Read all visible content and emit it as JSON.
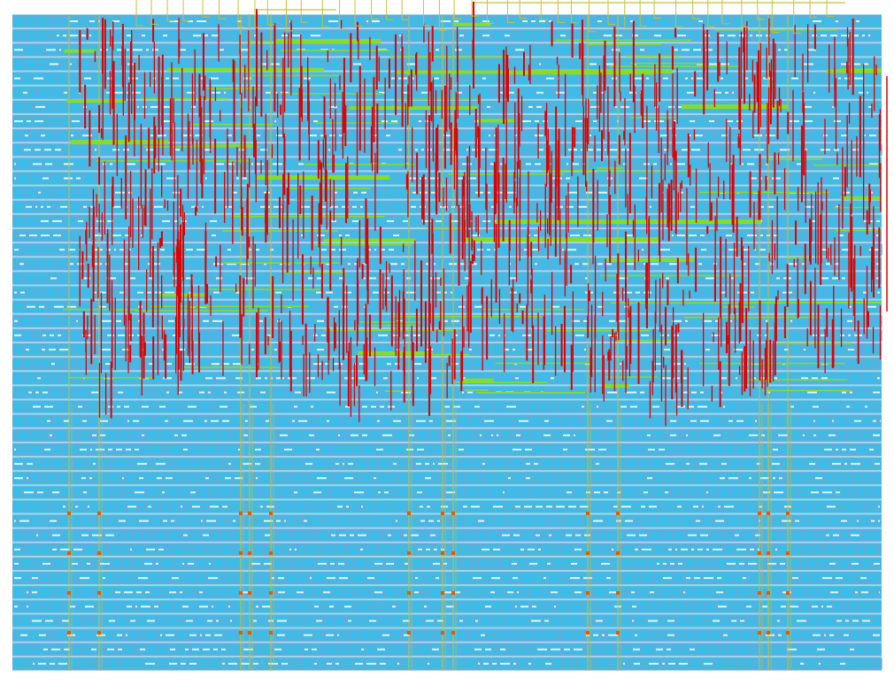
{
  "view": {
    "type": "chip-layout-render",
    "background": "#ffffff",
    "layers": [
      {
        "name": "standard-cells",
        "color": "#2ab7e8"
      },
      {
        "name": "cell-outline",
        "color": "#8a9fc0"
      },
      {
        "name": "metal-vertical",
        "color": "#dd0000"
      },
      {
        "name": "metal-horizontal",
        "color": "#86dc2c"
      },
      {
        "name": "power-straps",
        "color": "#c8be3c"
      },
      {
        "name": "io-pins",
        "color": "#e05a00"
      }
    ],
    "core_area": {
      "rows": 46,
      "row_pattern": "dense-cells"
    },
    "congested_region": {
      "description_level": "upper-60-percent"
    }
  }
}
